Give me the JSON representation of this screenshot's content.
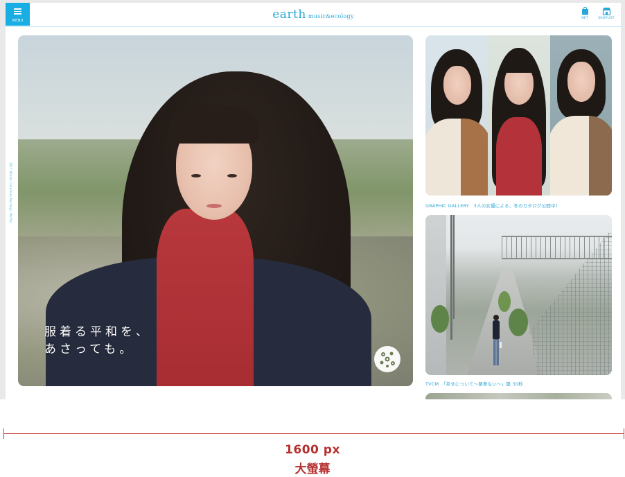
{
  "header": {
    "menu_label": "MENU",
    "logo_main": "earth",
    "logo_sub": "music&ecology",
    "icons": [
      {
        "name": "net-icon",
        "label": "NET"
      },
      {
        "name": "shoplist-icon",
        "label": "SHOPLIST"
      }
    ]
  },
  "side_copyright": "2017 Winter Collection Nostalgic Waffle",
  "hero": {
    "line1": "服着る平和を、",
    "line2": "あさっても。",
    "emblem_icon": "floral-emblem-icon"
  },
  "cards": [
    {
      "caption": "GRAPHIC GALLERY　3人の女優による、冬のカタログ公開中！"
    },
    {
      "caption": "TVCM　「幸せについて～悪意ない～」篇 30秒"
    }
  ],
  "annotation": {
    "width_label": "1600 px",
    "screen_label": "大螢幕"
  },
  "colors": {
    "accent": "#19aee3",
    "link": "#2aa6d6",
    "annotation": "#c53c3c"
  }
}
